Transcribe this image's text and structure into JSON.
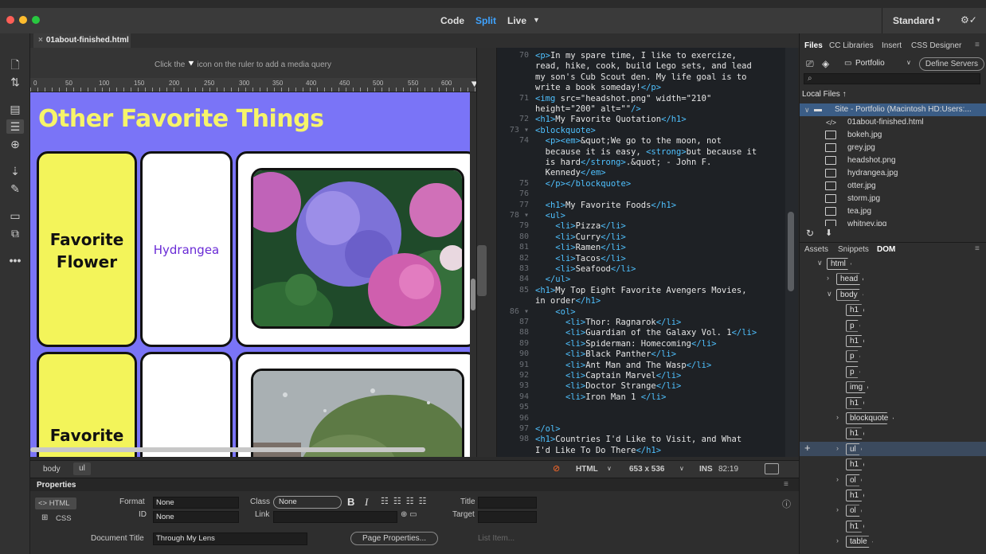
{
  "window": {
    "modes": [
      "Code",
      "Split",
      "Live"
    ],
    "active_mode": "Split",
    "workspace": "Standard",
    "workspace_chevron": "▾",
    "sync_icon": "⚙✓"
  },
  "document": {
    "tab_title": "01about-finished.html",
    "mq_hint_before": "Click the",
    "mq_hint_after": "icon on the ruler to add a media query",
    "ruler_ticks": [
      "0",
      "50",
      "100",
      "150",
      "200",
      "250",
      "300",
      "350",
      "400",
      "450",
      "500",
      "550",
      "600"
    ]
  },
  "design": {
    "heading": "Other Favorite Things",
    "row1_label_line1": "Favorite",
    "row1_label_line2": "Flower",
    "row1_value": "Hydrangea",
    "row2_label": "Favorite"
  },
  "code_lines": [
    {
      "n": "70",
      "t": "<p>In my spare time, I like to exercize,"
    },
    {
      "n": "",
      "t": "read, hike, cook, build Lego sets, and lead"
    },
    {
      "n": "",
      "t": "my son's Cub Scout den. My life goal is to"
    },
    {
      "n": "",
      "t": "write a book someday!</p>"
    },
    {
      "n": "71",
      "t": "<img src=\"headshot.png\" width=\"210\""
    },
    {
      "n": "",
      "t": "height=\"200\" alt=\"\"/>"
    },
    {
      "n": "72",
      "t": "<h1>My Favorite Quotation</h1>"
    },
    {
      "n": "73 ▾",
      "t": "<blockquote>"
    },
    {
      "n": "74",
      "t": "  <p><em>&quot;We go to the moon, not"
    },
    {
      "n": "",
      "t": "  because it is easy, <strong>but because it"
    },
    {
      "n": "",
      "t": "  is hard</strong>.&quot; - John F."
    },
    {
      "n": "",
      "t": "  Kennedy</em>"
    },
    {
      "n": "75",
      "t": "  </p></blockquote>"
    },
    {
      "n": "76",
      "t": ""
    },
    {
      "n": "77",
      "t": "  <h1>My Favorite Foods</h1>"
    },
    {
      "n": "78 ▾",
      "t": "  <ul>"
    },
    {
      "n": "79",
      "t": "    <li>Pizza</li>"
    },
    {
      "n": "80",
      "t": "    <li>Curry</li>"
    },
    {
      "n": "81",
      "t": "    <li>Ramen</li>"
    },
    {
      "n": "82",
      "t": "    <li>Tacos</li>"
    },
    {
      "n": "83",
      "t": "    <li>Seafood</li>"
    },
    {
      "n": "84",
      "t": "  </ul>"
    },
    {
      "n": "85",
      "t": "<h1>My Top Eight Favorite Avengers Movies,"
    },
    {
      "n": "",
      "t": "in order</h1>"
    },
    {
      "n": "86 ▾",
      "t": "    <ol>"
    },
    {
      "n": "87",
      "t": "      <li>Thor: Ragnarok</li>"
    },
    {
      "n": "88",
      "t": "      <li>Guardian of the Galaxy Vol. 1</li>"
    },
    {
      "n": "89",
      "t": "      <li>Spiderman: Homecoming</li>"
    },
    {
      "n": "90",
      "t": "      <li>Black Panther</li>"
    },
    {
      "n": "91",
      "t": "      <li>Ant Man and The Wasp</li>"
    },
    {
      "n": "92",
      "t": "      <li>Captain Marvel</li>"
    },
    {
      "n": "93",
      "t": "      <li>Doctor Strange</li>"
    },
    {
      "n": "94",
      "t": "      <li>Iron Man 1 </li>"
    },
    {
      "n": "95",
      "t": ""
    },
    {
      "n": "96",
      "t": ""
    },
    {
      "n": "97",
      "t": "</ol>"
    },
    {
      "n": "98",
      "t": "<h1>Countries I'd Like to Visit, and What"
    },
    {
      "n": "",
      "t": "I'd Like To Do There</h1>"
    }
  ],
  "statusbar": {
    "tags": [
      "body",
      "ul"
    ],
    "doc_type": "HTML",
    "size": "653 x 536",
    "ins": "INS",
    "cursor": "82:19"
  },
  "properties": {
    "title": "Properties",
    "html_btn": "<> HTML",
    "css_btn": "CSS",
    "format_label": "Format",
    "format_value": "None",
    "id_label": "ID",
    "id_value": "None",
    "class_label": "Class",
    "class_value": "None",
    "link_label": "Link",
    "title_label": "Title",
    "target_label": "Target",
    "doc_title_label": "Document Title",
    "doc_title_value": "Through My Lens",
    "page_props": "Page Properties...",
    "list_item": "List Item..."
  },
  "files_panel": {
    "tabs": [
      "Files",
      "CC Libraries",
      "Insert",
      "CSS Designer"
    ],
    "site": "Portfolio",
    "define_servers": "Define Servers",
    "local_files": "Local Files ↑",
    "site_root": "Site - Portfolio (Macintosh HD:Users:...",
    "files": [
      "01about-finished.html",
      "bokeh.jpg",
      "grey.jpg",
      "headshot.png",
      "hydrangea.jpg",
      "otter.jpg",
      "storm.jpg",
      "tea.jpg",
      "whitney.jpg"
    ]
  },
  "dom_panel": {
    "tabs": [
      "Assets",
      "Snippets",
      "DOM"
    ],
    "nodes": [
      {
        "label": "html",
        "indent": 0,
        "chev": "∨"
      },
      {
        "label": "head",
        "indent": 1,
        "chev": "›"
      },
      {
        "label": "body",
        "indent": 1,
        "chev": "∨"
      },
      {
        "label": "h1",
        "indent": 2,
        "chev": ""
      },
      {
        "label": "p",
        "indent": 2,
        "chev": ""
      },
      {
        "label": "h1",
        "indent": 2,
        "chev": ""
      },
      {
        "label": "p",
        "indent": 2,
        "chev": ""
      },
      {
        "label": "p",
        "indent": 2,
        "chev": ""
      },
      {
        "label": "img",
        "indent": 2,
        "chev": ""
      },
      {
        "label": "h1",
        "indent": 2,
        "chev": ""
      },
      {
        "label": "blockquote",
        "indent": 2,
        "chev": "›"
      },
      {
        "label": "h1",
        "indent": 2,
        "chev": ""
      },
      {
        "label": "ul",
        "indent": 2,
        "chev": "›"
      },
      {
        "label": "h1",
        "indent": 2,
        "chev": ""
      },
      {
        "label": "ol",
        "indent": 2,
        "chev": "›"
      },
      {
        "label": "h1",
        "indent": 2,
        "chev": ""
      },
      {
        "label": "ol",
        "indent": 2,
        "chev": "›"
      },
      {
        "label": "h1",
        "indent": 2,
        "chev": ""
      },
      {
        "label": "table",
        "indent": 2,
        "chev": "›"
      }
    ],
    "selected_index": 12
  },
  "colors": {
    "accent": "#3fa3ff",
    "page_bg": "#7a74f7",
    "heading": "#f6f46a",
    "card_yellow": "#f3f45a",
    "code_tag": "#4fc1ff",
    "hydrangea_text": "#6a2bd6"
  }
}
